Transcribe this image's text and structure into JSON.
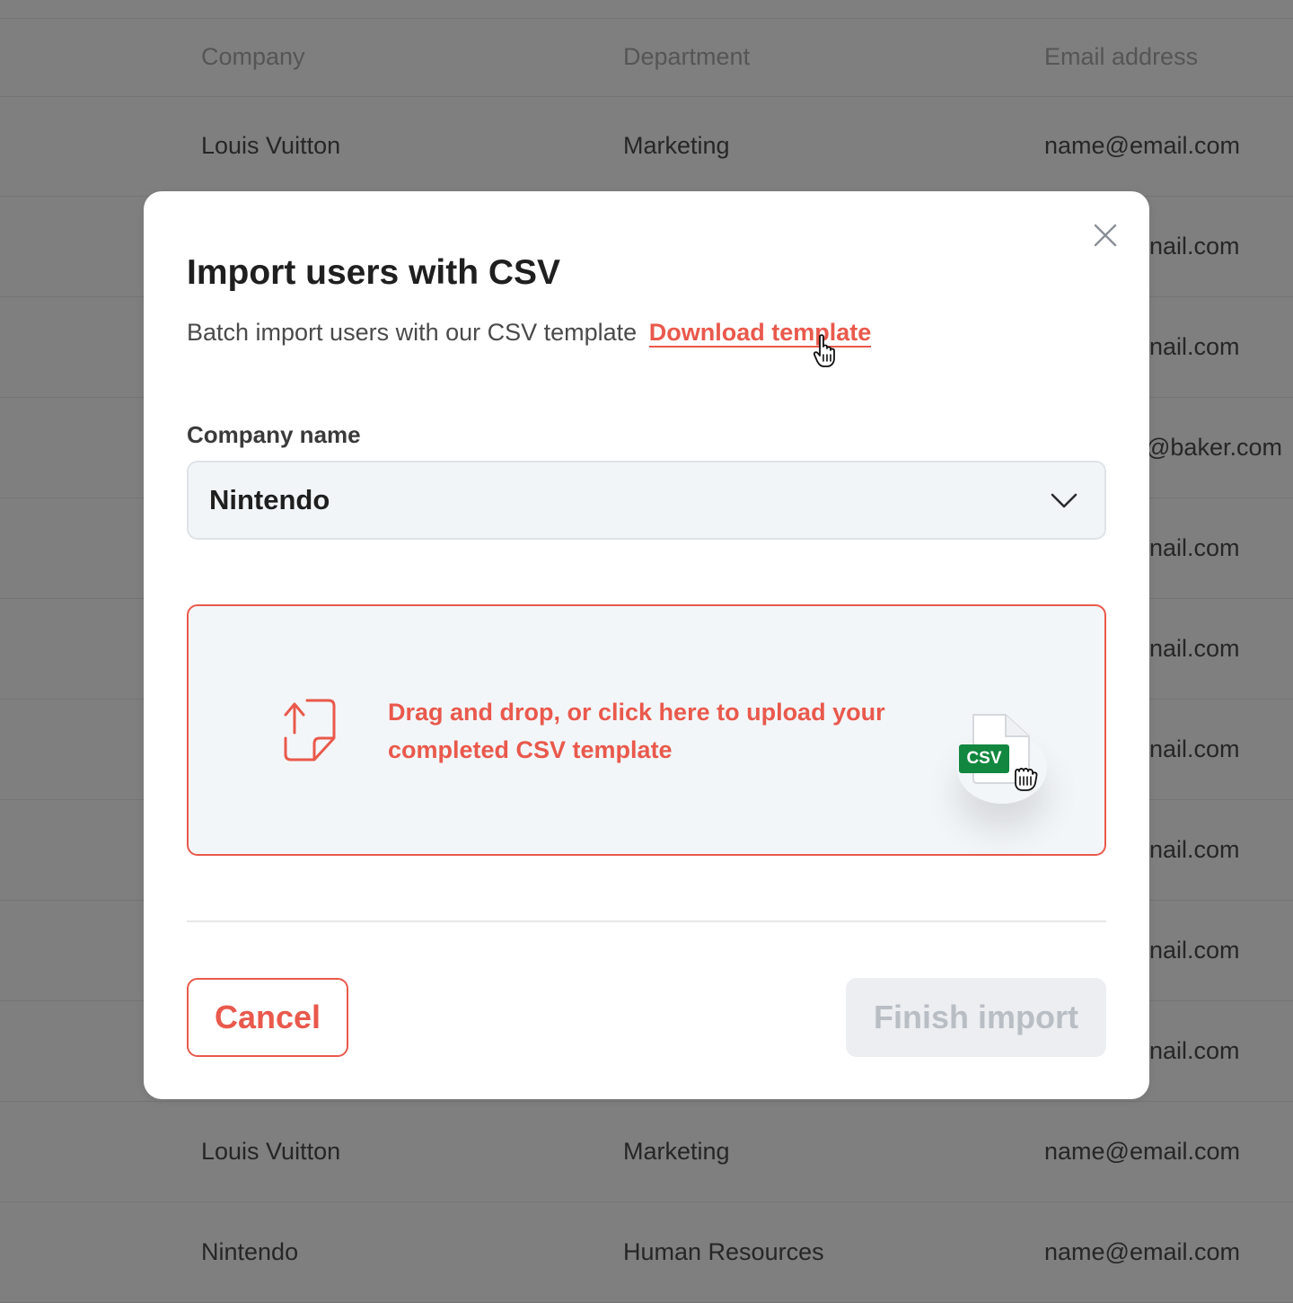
{
  "table": {
    "headers": [
      "Company",
      "Department",
      "Email address"
    ],
    "rows": [
      {
        "company": "Louis Vuitton",
        "department": "Marketing",
        "email": "name@email.com"
      },
      {
        "company": "",
        "department": "",
        "email": "nail.com"
      },
      {
        "company": "",
        "department": "",
        "email": "nail.com"
      },
      {
        "company": "",
        "department": "",
        "email": "@baker.com"
      },
      {
        "company": "",
        "department": "",
        "email": "nail.com"
      },
      {
        "company": "",
        "department": "",
        "email": "nail.com"
      },
      {
        "company": "",
        "department": "",
        "email": "nail.com"
      },
      {
        "company": "",
        "department": "",
        "email": "nail.com"
      },
      {
        "company": "",
        "department": "",
        "email": "nail.com"
      },
      {
        "company": "",
        "department": "",
        "email": "nail.com"
      },
      {
        "company": "Louis Vuitton",
        "department": "Marketing",
        "email": "name@email.com"
      },
      {
        "company": "Nintendo",
        "department": "Human Resources",
        "email": "name@email.com"
      }
    ]
  },
  "modal": {
    "title": "Import users with CSV",
    "subtitle": "Batch import users with our CSV template",
    "download_link": "Download template",
    "field_label": "Company name",
    "company_value": "Nintendo",
    "dropzone_text": "Drag and drop, or click here to upload your completed CSV template",
    "file_badge": "CSV",
    "cancel_label": "Cancel",
    "finish_label": "Finish import"
  },
  "icons": {
    "close": "close-icon",
    "chevron": "chevron-down-icon",
    "upload": "upload-file-icon",
    "file": "csv-file-icon",
    "pointer": "hand-pointer-cursor-icon",
    "grab": "hand-grab-cursor-icon"
  },
  "colors": {
    "accent": "#e9594c",
    "csv_badge": "#12873f",
    "overlay": "#7f7f7f",
    "disabled_text": "#b9bec5"
  }
}
